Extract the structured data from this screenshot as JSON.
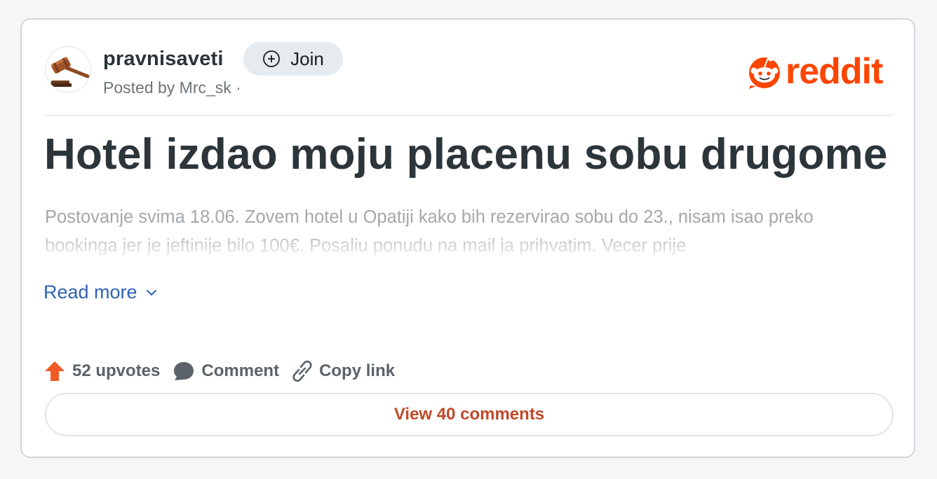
{
  "post": {
    "subreddit": "pravnisaveti",
    "join_label": "Join",
    "posted_by": "Posted by Mrc_sk ·",
    "title": "Hotel izdao moju placenu sobu drugome",
    "body_preview": "Postovanje svima 18.06. Zovem hotel u Opatiji kako bih rezervirao sobu do 23., nisam isao preko bookinga jer je jeftinije bilo 100€. Posaliu ponudu na mail ja prihvatim. Vecer prije",
    "read_more": "Read more"
  },
  "brand": {
    "wordmark": "reddit",
    "color": "#ff4500"
  },
  "actions": {
    "upvotes": "52 upvotes",
    "comment": "Comment",
    "copy_link": "Copy link",
    "view_comments": "View 40 comments"
  },
  "icons": {
    "avatar": "gavel-icon",
    "join": "plus-circle-icon",
    "logo": "reddit-snoo-icon",
    "read_more": "chevron-down-icon",
    "upvote": "upvote-arrow-icon",
    "comment": "comment-bubble-icon",
    "copy": "link-icon"
  },
  "colors": {
    "upvote": "#f05a28",
    "link": "#2e62b4",
    "view_comments": "#c0492a"
  }
}
